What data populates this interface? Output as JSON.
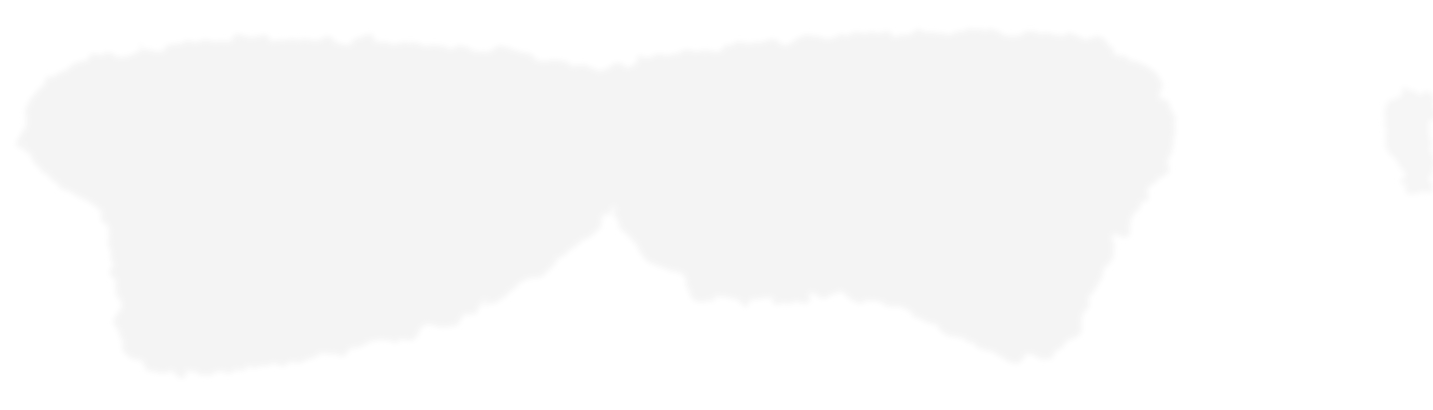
{
  "image": {
    "background_color": "#ffffff",
    "smudge_color": "#f4f4f4",
    "edge_smudge_color": "#f6f6f6"
  }
}
